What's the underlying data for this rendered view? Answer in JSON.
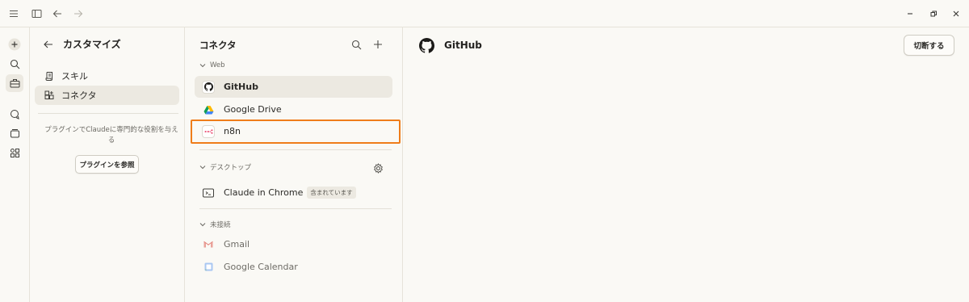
{
  "customize": {
    "title": "カスタマイズ",
    "nav": [
      {
        "label": "スキル"
      },
      {
        "label": "コネクタ"
      }
    ],
    "plugin_text": "プラグインでClaudeに専門的な役割を与える",
    "plugin_button": "プラグインを参照"
  },
  "connectors": {
    "title": "コネクタ",
    "sections": {
      "web": "Web",
      "desktop": "デスクトップ",
      "disconnected": "未接続"
    },
    "web_items": [
      "GitHub",
      "Google Drive",
      "n8n"
    ],
    "desktop_items": [
      {
        "label": "Claude in Chrome",
        "badge": "含まれています"
      }
    ],
    "disconnected_items": [
      "Gmail",
      "Google Calendar"
    ]
  },
  "detail": {
    "title": "GitHub",
    "disconnect_button": "切断する"
  },
  "colors": {
    "background": "#faf9f5",
    "active_bg": "#ece9e1",
    "highlight": "#ef7d1a"
  }
}
